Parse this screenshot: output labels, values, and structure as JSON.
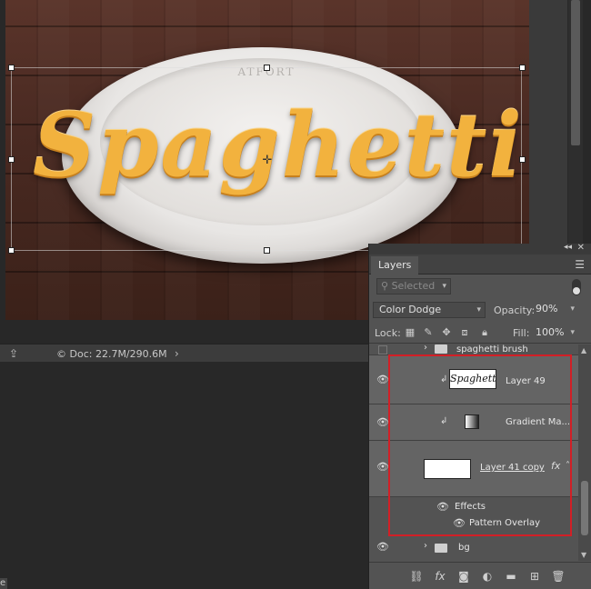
{
  "canvas": {
    "title_text": "Spaghetti",
    "stamp_text": "ATFORT",
    "colors": {
      "wood": "#4a2a22",
      "text": "#f2b23e",
      "plate": "#e8e6e4"
    }
  },
  "status_bar": {
    "doc_info": "Doc: 22.7M/290.6M",
    "share_icon": "share-icon",
    "arrow_icon": "chevron-right-icon"
  },
  "lower_tab": {
    "label": "e"
  },
  "layers_panel": {
    "tab_label": "Layers",
    "filter_placeholder": "Selected",
    "blend_mode": "Color Dodge",
    "opacity_label": "Opacity:",
    "opacity_value": "90%",
    "lock_label": "Lock:",
    "fill_label": "Fill:",
    "fill_value": "100%",
    "layers": [
      {
        "name": "spaghetti brush",
        "type": "group",
        "visible": false
      },
      {
        "name": "Layer 49",
        "type": "pixel",
        "clipped": true,
        "thumb_text": "Spaghetti",
        "visible": true
      },
      {
        "name": "Gradient Ma...",
        "type": "adjustment",
        "clipped": true,
        "visible": true
      },
      {
        "name": "Layer 41 copy",
        "type": "pixel",
        "fx": "fx",
        "visible": true
      }
    ],
    "effects_label": "Effects",
    "pattern_overlay_label": "Pattern Overlay",
    "bg_group_name": "bg",
    "footer_icons": [
      "link-icon",
      "fx-icon",
      "mask-icon",
      "adjustment-icon",
      "folder-icon",
      "new-layer-icon",
      "trash-icon"
    ],
    "highlight_color": "#d21f26"
  }
}
